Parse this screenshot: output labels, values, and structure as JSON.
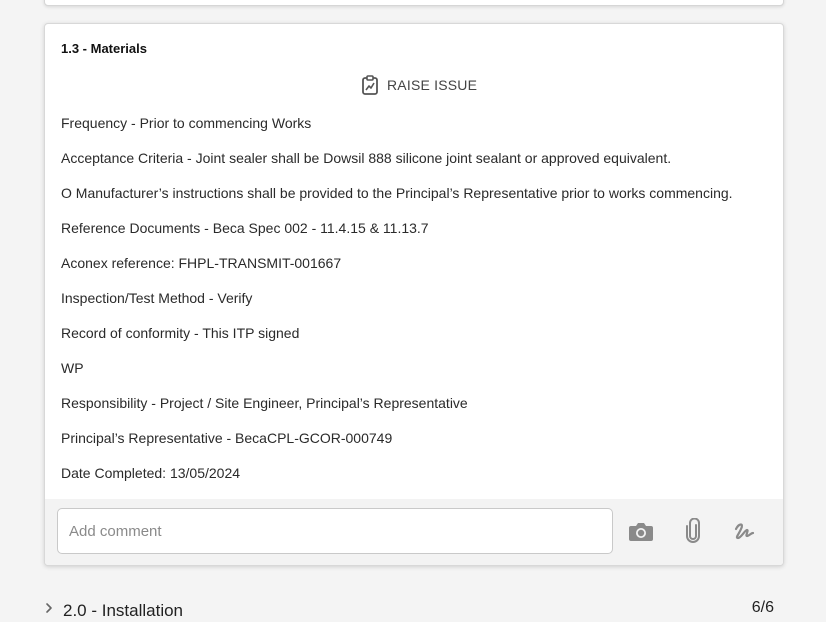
{
  "item": {
    "title": "1.3 - Materials",
    "raise_issue_label": "RAISE ISSUE",
    "lines": [
      "Frequency - Prior to commencing Works",
      "Acceptance Criteria - Joint sealer shall be Dowsil 888 silicone joint sealant or approved equivalent.",
      "O Manufacturer’s instructions shall be provided to the Principal’s Representative prior to works commencing.",
      "Reference Documents - Beca Spec 002 - 11.4.15 & 11.13.7",
      "Aconex reference: FHPL-TRANSMIT-001667",
      "Inspection/Test Method - Verify",
      "Record of conformity - This ITP signed",
      "WP",
      "Responsibility - Project / Site Engineer, Principal’s Representative",
      "Principal’s Representative - BecaCPL-GCOR-000749",
      "Date Completed: 13/05/2024"
    ]
  },
  "comment": {
    "placeholder": "Add comment",
    "value": "",
    "icons": [
      "camera-icon",
      "paperclip-icon",
      "signature-icon"
    ]
  },
  "next_section": {
    "title": "2.0 - Installation",
    "count": "6/6"
  },
  "colors": {
    "icon": "#8a8a8a",
    "text": "#2a2a2a",
    "card_bg": "#ffffff",
    "bar_bg": "#f3f3f3"
  }
}
